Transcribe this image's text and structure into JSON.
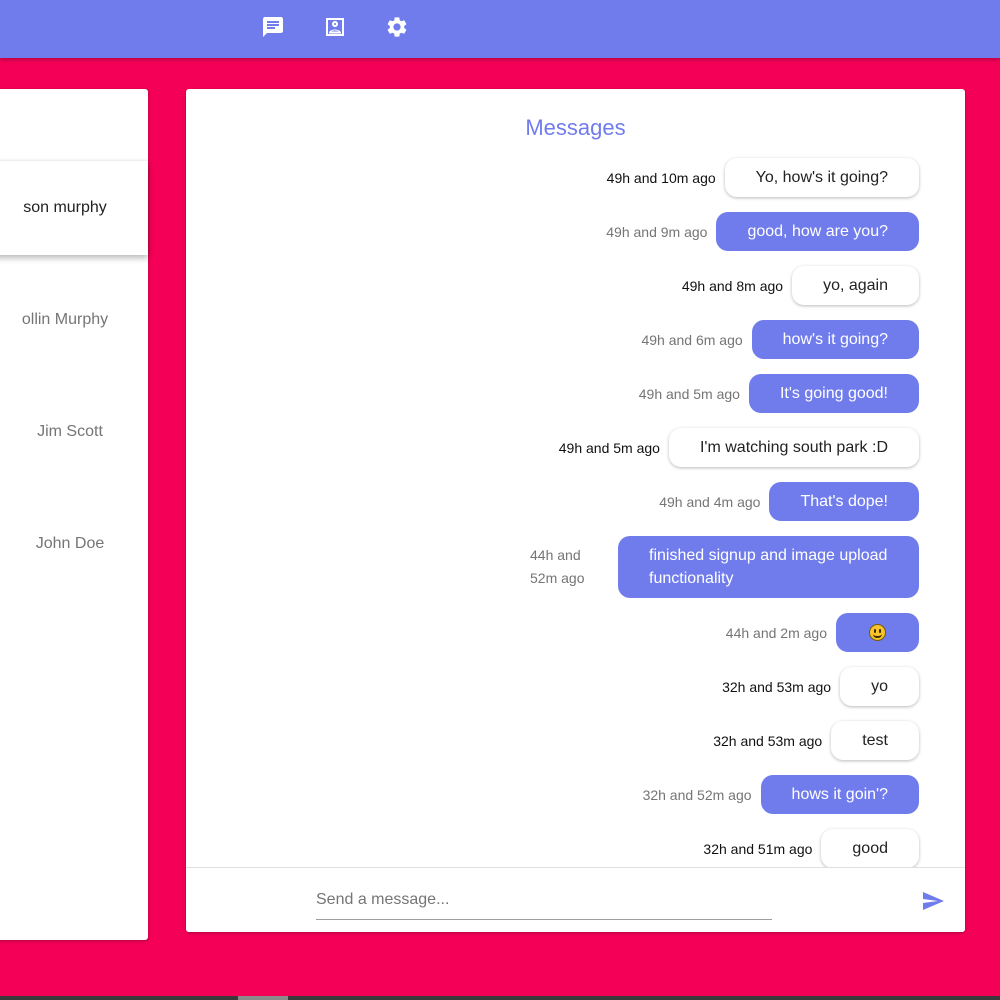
{
  "nav": {
    "icons": [
      "chat-icon",
      "contact-icon",
      "settings-icon"
    ]
  },
  "contacts": [
    {
      "name": "son murphy",
      "selected": true
    },
    {
      "name": "ollin Murphy",
      "selected": false
    },
    {
      "name": "Jim Scott",
      "selected": false
    },
    {
      "name": "John Doe",
      "selected": false
    }
  ],
  "chat": {
    "title": "Messages",
    "messages": [
      {
        "time": "49h and 10m ago",
        "text": "Yo, how's it going?",
        "mine": false
      },
      {
        "time": "49h and 9m ago",
        "text": "good, how are you?",
        "mine": true
      },
      {
        "time": "49h and 8m ago",
        "text": "yo, again",
        "mine": false
      },
      {
        "time": "49h and 6m ago",
        "text": "how's it going?",
        "mine": true
      },
      {
        "time": "49h and 5m ago",
        "text": "It's going good!",
        "mine": true
      },
      {
        "time": "49h and 5m ago",
        "text": "I'm watching south park :D",
        "mine": false
      },
      {
        "time": "49h and 4m ago",
        "text": "That's dope!",
        "mine": true
      },
      {
        "time": "44h and 52m ago",
        "text": "finished signup and image upload functionality",
        "mine": true
      },
      {
        "time": "44h and 2m ago",
        "text": "",
        "emoji": "smiley-emoji",
        "mine": true
      },
      {
        "time": "32h and 53m ago",
        "text": "yo",
        "mine": false
      },
      {
        "time": "32h and 53m ago",
        "text": "test",
        "mine": false
      },
      {
        "time": "32h and 52m ago",
        "text": "hows it goin'?",
        "mine": true
      },
      {
        "time": "32h and 51m ago",
        "text": "good",
        "mine": false
      }
    ]
  },
  "composer": {
    "placeholder": "Send a message...",
    "value": ""
  },
  "colors": {
    "primary": "#717CEC",
    "background": "#F50057",
    "surface": "#FFFFFF"
  }
}
